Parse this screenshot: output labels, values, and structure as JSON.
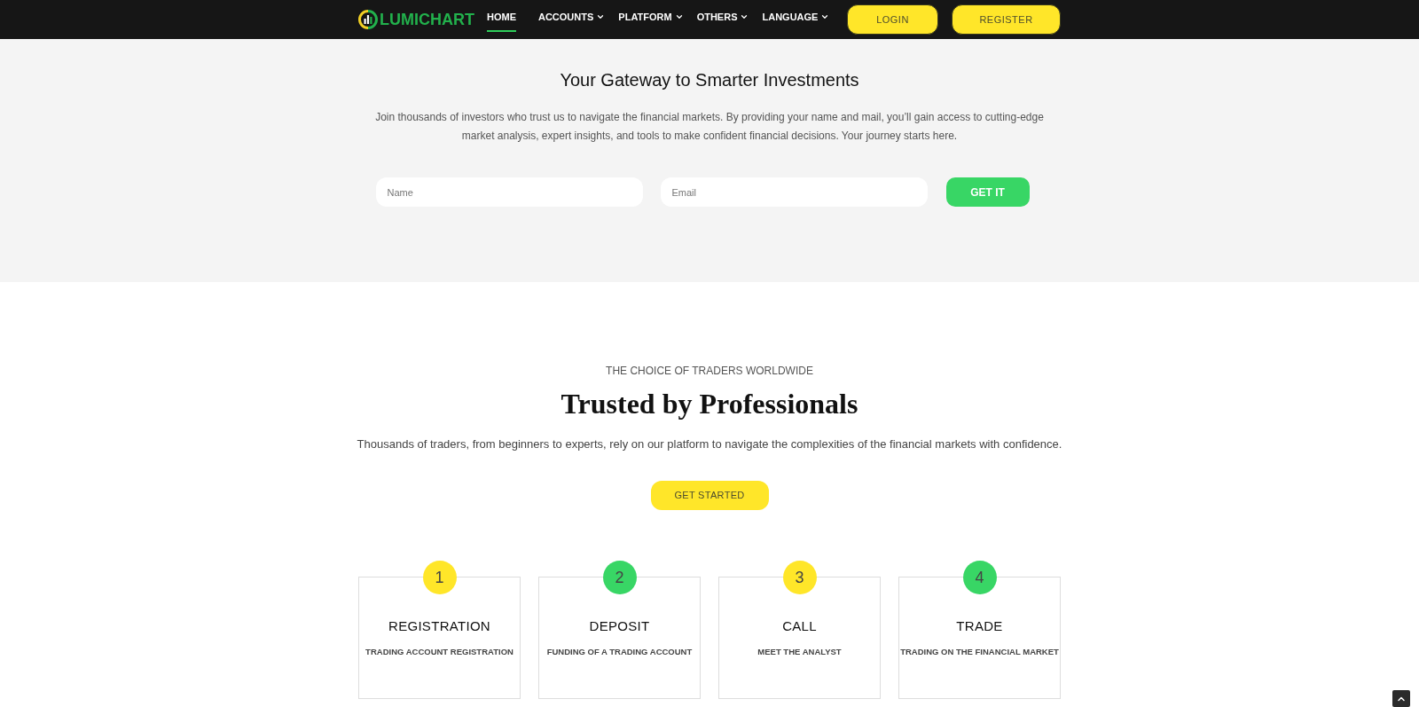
{
  "header": {
    "logo": {
      "text": "LUMICHART"
    },
    "nav": [
      {
        "label": "HOME",
        "kind": "link",
        "selected": true
      },
      {
        "label": "ACCOUNTS",
        "kind": "dropdown",
        "selected": false
      },
      {
        "label": "PLATFORM",
        "kind": "dropdown",
        "selected": false
      },
      {
        "label": "OTHERS",
        "kind": "dropdown",
        "selected": false
      },
      {
        "label": "LANGUAGE",
        "kind": "dropdown",
        "selected": false
      }
    ],
    "buttons": [
      {
        "label": "LOGIN"
      },
      {
        "label": "REGISTER"
      }
    ]
  },
  "hero": {
    "title": "Your Gateway to Smarter Investments",
    "text": "Join thousands of investors who trust us to navigate the financial markets. By providing your name and mail, you’ll gain access to cutting-edge market analysis, expert insights, and tools to make confident financial decisions. Your journey starts here.",
    "form": {
      "fields": [
        {
          "placeholder": "Name"
        },
        {
          "placeholder": "Email"
        }
      ],
      "submit": "GET IT"
    }
  },
  "trust": {
    "eyebrow": "THE CHOICE OF TRADERS WORLDWIDE",
    "title": "Trusted by Professionals",
    "text": "Thousands of traders, from beginners to experts, rely on our platform to navigate the complexities of the financial markets with confidence.",
    "button": "GET STARTED",
    "steps": [
      {
        "number": "1",
        "title": "REGISTRATION",
        "subtitle": "TRADING ACCOUNT REGISTRATION",
        "color": "#ffe629"
      },
      {
        "number": "2",
        "title": "DEPOSIT",
        "subtitle": "FUNDING OF A TRADING ACCOUNT",
        "color": "#38d665"
      },
      {
        "number": "3",
        "title": "CALL",
        "subtitle": "MEET THE ANALYST",
        "color": "#ffe629"
      },
      {
        "number": "4",
        "title": "TRADE",
        "subtitle": "TRADING ON THE FINANCIAL MARKET",
        "color": "#38d665"
      }
    ]
  }
}
